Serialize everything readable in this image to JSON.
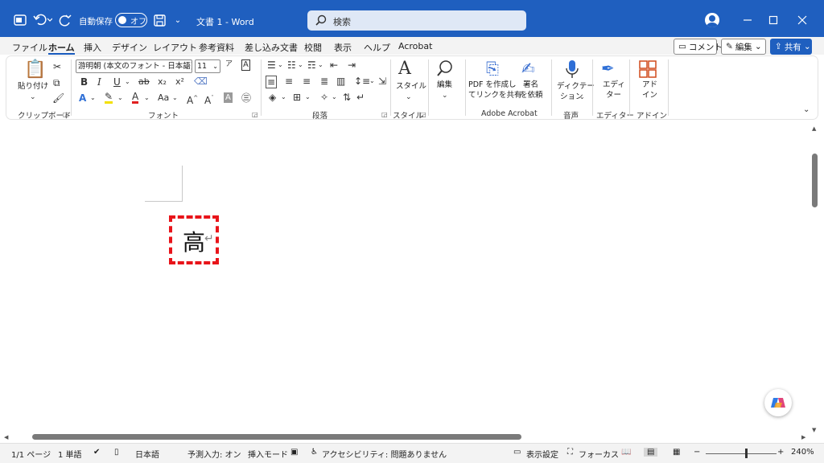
{
  "titlebar": {
    "autosave_label": "自動保存",
    "autosave_state": "オフ",
    "doc_title": "文書 1  -  Word",
    "search_placeholder": "検索"
  },
  "tabs": [
    "ファイル",
    "ホーム",
    "挿入",
    "デザイン",
    "レイアウト",
    "参考資料",
    "差し込み文書",
    "校閲",
    "表示",
    "ヘルプ",
    "Acrobat"
  ],
  "active_tab": "ホーム",
  "ribbon_buttons": {
    "comment": "コメント",
    "edit": "編集",
    "share": "共有"
  },
  "ribbon": {
    "clipboard": {
      "paste": "貼り付け",
      "label": "クリップボード"
    },
    "font": {
      "font_name": "游明朝 (本文のフォント - 日本語)",
      "font_size": "11",
      "case_label": "Aa",
      "label": "フォント"
    },
    "paragraph": {
      "label": "段落"
    },
    "styles": {
      "button": "スタイル",
      "label": "スタイル"
    },
    "editing": {
      "button": "編集"
    },
    "acrobat": {
      "pdf_line1": "PDF を作成し",
      "pdf_line2": "てリンクを共有",
      "sign_line1": "署名",
      "sign_line2": "を依頼",
      "label": "Adobe Acrobat"
    },
    "voice": {
      "line1": "ディクテー",
      "line2": "ション",
      "label": "音声"
    },
    "editor": {
      "line1": "エディ",
      "line2": "ター",
      "label": "エディター"
    },
    "addins": {
      "line1": "アド",
      "line2": "イン",
      "label": "アドイン"
    }
  },
  "document": {
    "text": "高",
    "para_mark": "↵"
  },
  "statusbar": {
    "page": "1/1 ページ",
    "words": "1 単語",
    "language": "日本語",
    "predictive": "予測入力: オン",
    "insert_mode": "挿入モード",
    "accessibility": "アクセシビリティ: 問題ありません",
    "display_settings": "表示設定",
    "focus": "フォーカス",
    "zoom": "240%"
  },
  "colors": {
    "titlebar": "#1f5fbf",
    "highlight_box": "#e8141a"
  }
}
